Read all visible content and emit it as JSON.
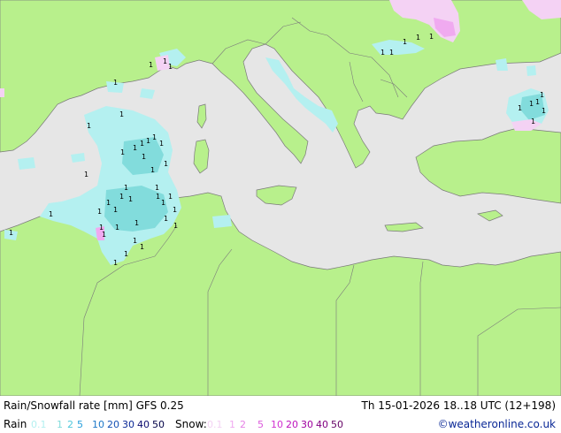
{
  "title": "Rain/Snowfall rate [mm] GFS 0.25",
  "datetime": "Th 15-01-2026 18..18 UTC (12+198)",
  "rain_label": "Rain",
  "rain_levels": [
    "0.1",
    "1",
    "2",
    "5",
    "10",
    "20",
    "30",
    "40",
    "50"
  ],
  "rain_colors": [
    "#b4f0f0",
    "#82dcdc",
    "#50c8dc",
    "#28a0dc",
    "#1e78c8",
    "#1450b4",
    "#0a2896",
    "#0a0a6e",
    "#000046"
  ],
  "snow_label": "Snow:",
  "snow_levels": [
    "0.1",
    "1",
    "2",
    "5",
    "10",
    "20",
    "30",
    "40",
    "50"
  ],
  "snow_colors": [
    "#f4d2f4",
    "#f0aaf0",
    "#e682e6",
    "#dc5adc",
    "#d232d2",
    "#be14be",
    "#a000a0",
    "#820082",
    "#640064"
  ],
  "credit": "©weatheronline.co.uk",
  "map": {
    "land_color": "#b8f08c",
    "sea_color": "#e6e6e6",
    "border_color": "#7a7a7a",
    "marker_symbol": "1"
  }
}
